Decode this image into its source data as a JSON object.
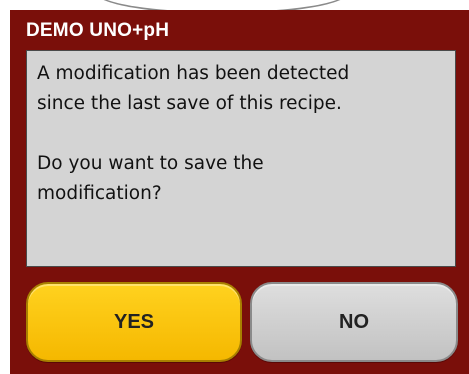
{
  "dialog": {
    "title": "DEMO UNO+pH",
    "message": {
      "line1": "A modification has been detected",
      "line2": "since the last save of this recipe.",
      "line3": "Do you want to save the",
      "line4": "modification?"
    },
    "buttons": {
      "yes_label": "YES",
      "no_label": "NO"
    }
  },
  "colors": {
    "dialog_background": "#7a0f0a",
    "message_background": "#d4d4d4",
    "yes_button": "#ffc800",
    "no_button": "#cfcfcf",
    "title_text": "#ffffff"
  }
}
